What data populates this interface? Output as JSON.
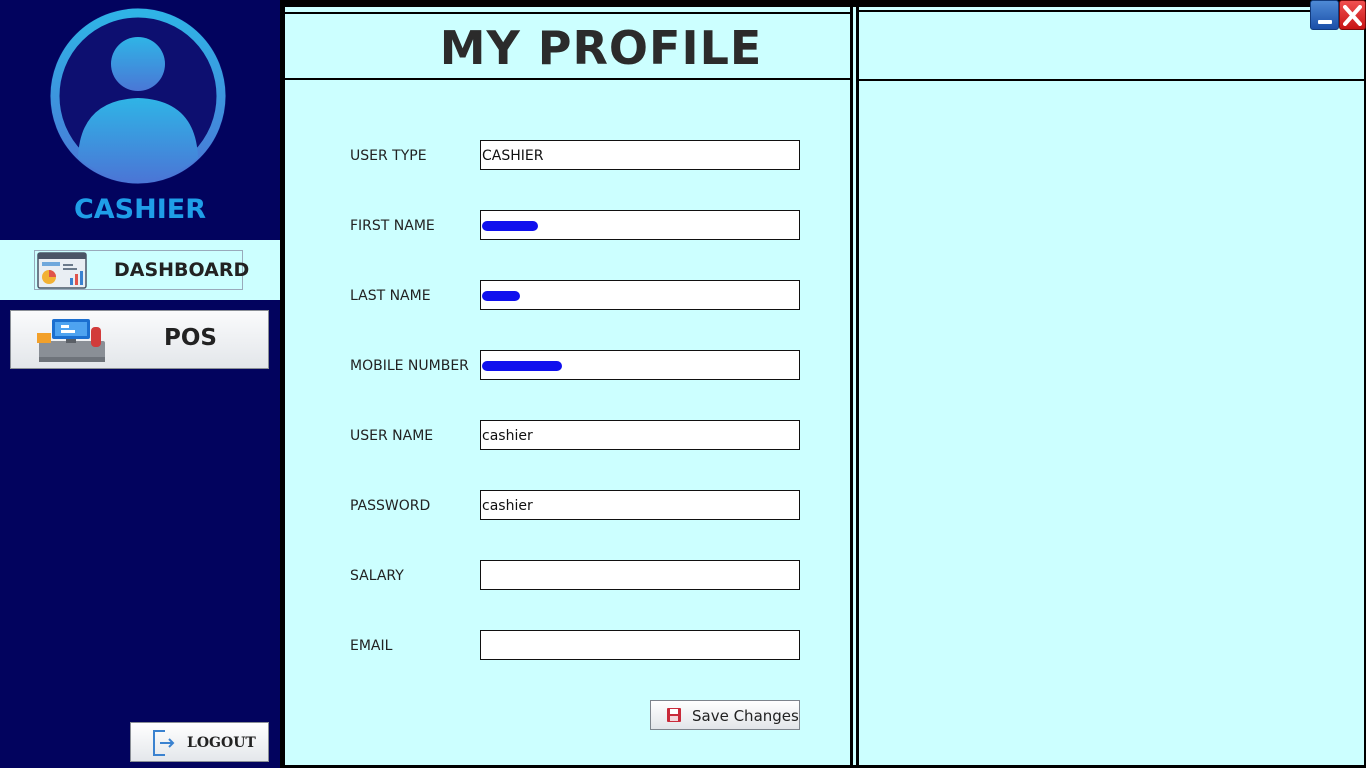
{
  "sidebar": {
    "role_title": "CASHIER",
    "nav": {
      "dashboard_label": "DASHBOARD",
      "pos_label": "POS",
      "logout_label": "LOGOUT"
    }
  },
  "main": {
    "title": "MY PROFILE",
    "fields": {
      "user_type": {
        "label": "USER TYPE",
        "value": "CASHIER"
      },
      "first_name": {
        "label": "FIRST NAME",
        "value": ""
      },
      "last_name": {
        "label": "LAST NAME",
        "value": ""
      },
      "mobile_number": {
        "label": "MOBILE NUMBER",
        "value": ""
      },
      "user_name": {
        "label": "USER NAME",
        "value": "cashier"
      },
      "password": {
        "label": "PASSWORD",
        "value": "cashier"
      },
      "salary": {
        "label": "SALARY",
        "value": ""
      },
      "email": {
        "label": "EMAIL",
        "value": ""
      }
    },
    "save_label": "Save Changes"
  },
  "colors": {
    "sidebar_bg": "#02035e",
    "panel_bg": "#ccffff",
    "accent": "#1f9ee8",
    "redaction": "#1010ee"
  },
  "icons": {
    "avatar": "user-avatar-icon",
    "dashboard": "dashboard-chart-icon",
    "pos": "cash-register-icon",
    "logout": "logout-door-icon",
    "save": "floppy-disk-icon",
    "minimize": "minimize-icon",
    "close": "close-icon"
  }
}
